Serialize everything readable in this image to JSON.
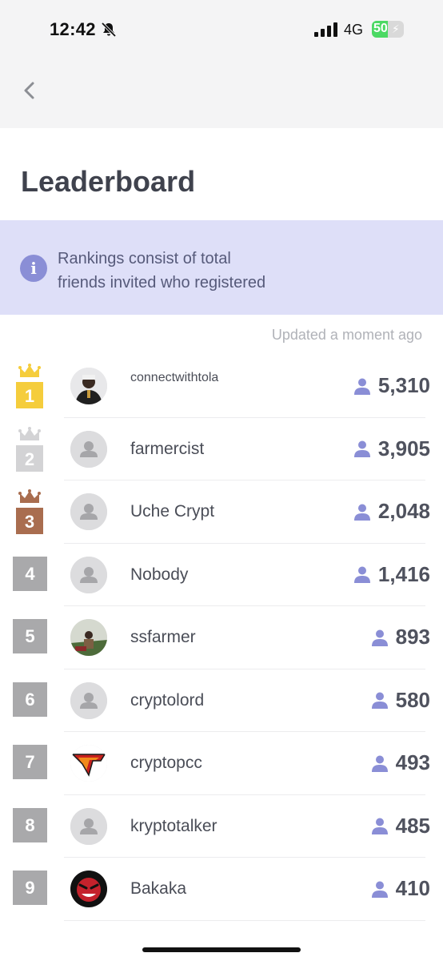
{
  "status_bar": {
    "time": "12:42",
    "network": "4G",
    "battery": "50"
  },
  "header": {
    "title": "Leaderboard"
  },
  "info": {
    "line1": "Rankings consist of total",
    "line2": "friends invited who registered"
  },
  "updated": "Updated a moment ago",
  "colors": {
    "gold": "#f5cd3c",
    "silver": "#d3d3d5",
    "bronze": "#a96d4f",
    "accent": "#8a8ed6",
    "banner": "#dedff8"
  },
  "leaderboard": [
    {
      "rank": "1",
      "name": "connectwithtola",
      "count": "5,310"
    },
    {
      "rank": "2",
      "name": "farmercist",
      "count": "3,905"
    },
    {
      "rank": "3",
      "name": "Uche Crypt",
      "count": "2,048"
    },
    {
      "rank": "4",
      "name": "Nobody",
      "count": "1,416"
    },
    {
      "rank": "5",
      "name": "ssfarmer",
      "count": "893"
    },
    {
      "rank": "6",
      "name": "cryptolord",
      "count": "580"
    },
    {
      "rank": "7",
      "name": "cryptopcc",
      "count": "493"
    },
    {
      "rank": "8",
      "name": "kryptotalker",
      "count": "485"
    },
    {
      "rank": "9",
      "name": "Bakaka",
      "count": "410"
    }
  ]
}
